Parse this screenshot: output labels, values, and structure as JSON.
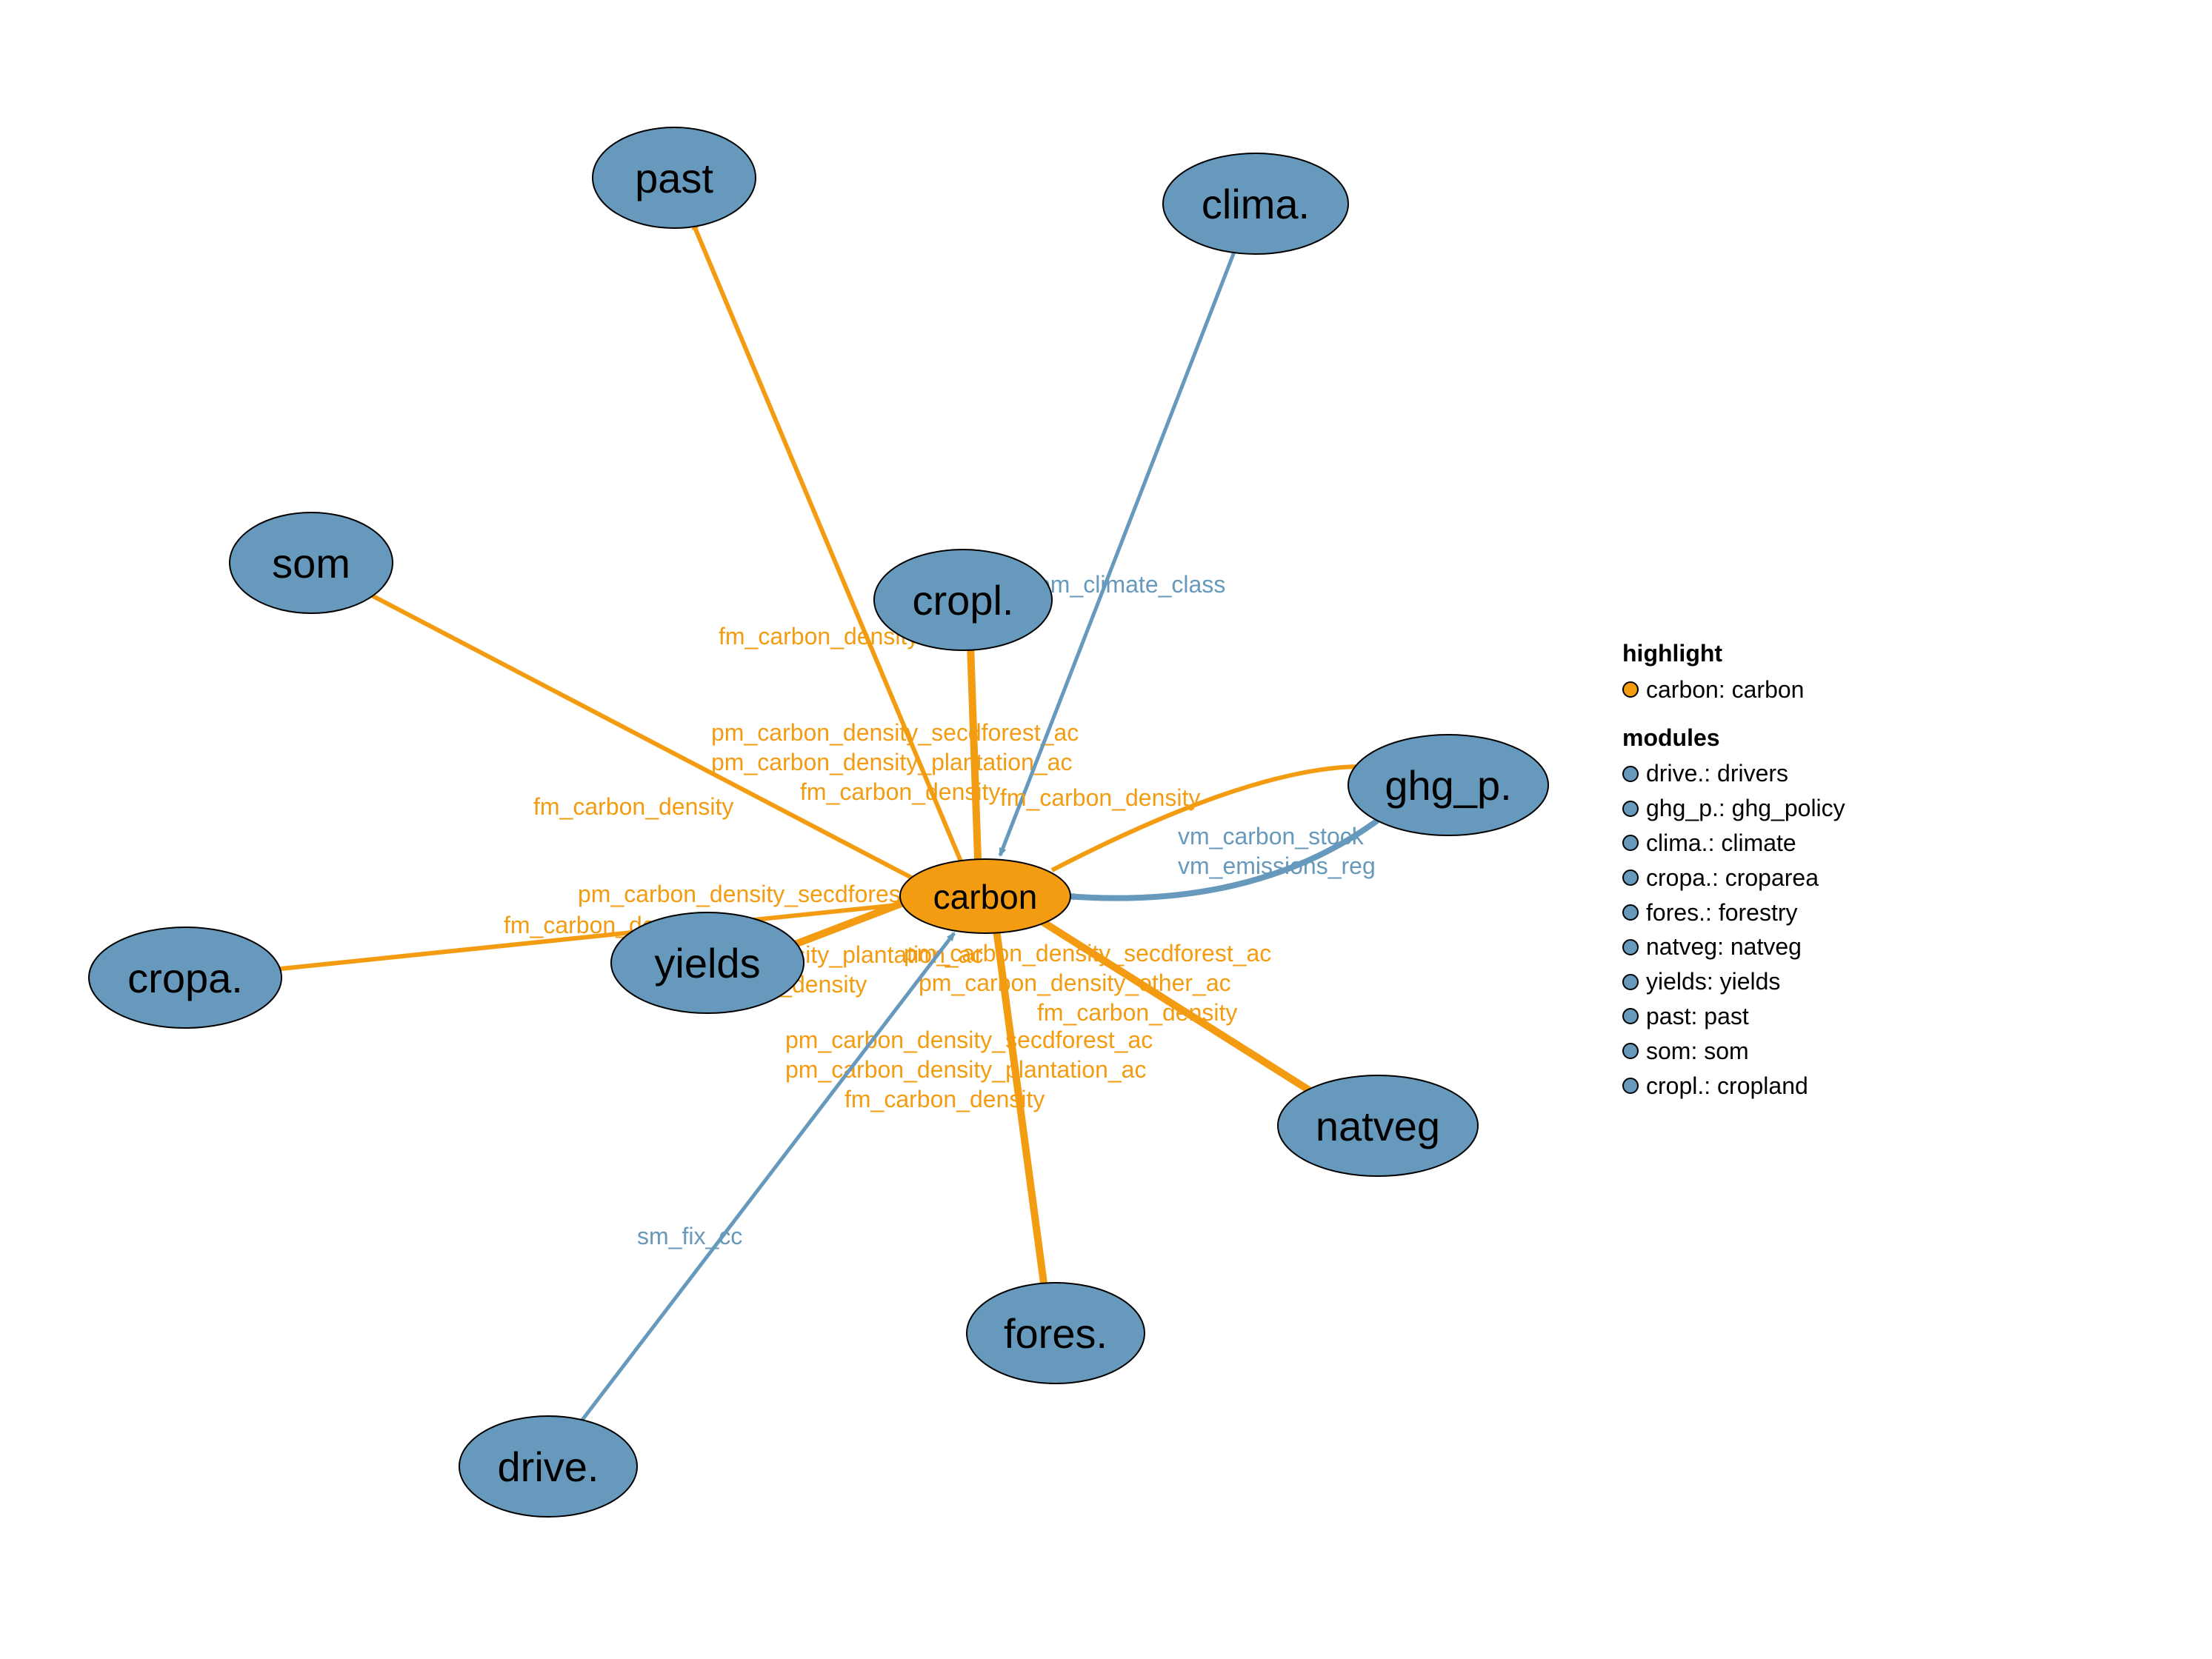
{
  "colors": {
    "node_blue": "#6699bb",
    "node_orange": "#f39c12",
    "edge_orange": "#f39c12",
    "edge_blue": "#6699bb"
  },
  "nodes": {
    "carbon": {
      "label": "carbon",
      "kind": "highlight"
    },
    "past": {
      "label": "past",
      "kind": "module"
    },
    "clima": {
      "label": "clima.",
      "kind": "module"
    },
    "som": {
      "label": "som",
      "kind": "module"
    },
    "cropl": {
      "label": "cropl.",
      "kind": "module"
    },
    "ghg_p": {
      "label": "ghg_p.",
      "kind": "module"
    },
    "cropa": {
      "label": "cropa.",
      "kind": "module"
    },
    "yields": {
      "label": "yields",
      "kind": "module"
    },
    "natveg": {
      "label": "natveg",
      "kind": "module"
    },
    "fores": {
      "label": "fores.",
      "kind": "module"
    },
    "drive": {
      "label": "drive.",
      "kind": "module"
    }
  },
  "edges": [
    {
      "from": "carbon",
      "to": "past",
      "labels": [
        "fm_carbon_density"
      ],
      "color": "orange"
    },
    {
      "from": "carbon",
      "to": "som",
      "labels": [
        "fm_carbon_density"
      ],
      "color": "orange"
    },
    {
      "from": "carbon",
      "to": "cropl",
      "labels": [
        "pm_carbon_density_secdforest_ac",
        "pm_carbon_density_plantation_ac",
        "fm_carbon_density"
      ],
      "color": "orange"
    },
    {
      "from": "carbon",
      "to": "ghg_p",
      "labels": [
        "fm_carbon_density"
      ],
      "color": "orange"
    },
    {
      "from": "ghg_p",
      "to": "carbon",
      "labels": [
        "vm_carbon_stock",
        "vm_emissions_reg"
      ],
      "color": "blue"
    },
    {
      "from": "carbon",
      "to": "cropa",
      "labels": [
        "fm_carbon_density"
      ],
      "color": "orange"
    },
    {
      "from": "carbon",
      "to": "yields",
      "labels": [
        "pm_carbon_density_secdforest_ac",
        "pm_carbon_density_plantation_ac",
        "fm_carbon_density"
      ],
      "color": "orange"
    },
    {
      "from": "carbon",
      "to": "natveg",
      "labels": [
        "pm_carbon_density_secdforest_ac",
        "pm_carbon_density_other_ac",
        "fm_carbon_density"
      ],
      "color": "orange"
    },
    {
      "from": "carbon",
      "to": "fores",
      "labels": [
        "pm_carbon_density_secdforest_ac",
        "pm_carbon_density_plantation_ac",
        "fm_carbon_density"
      ],
      "color": "orange"
    },
    {
      "from": "clima",
      "to": "carbon",
      "labels": [
        "pm_climate_class"
      ],
      "color": "blue"
    },
    {
      "from": "drive",
      "to": "carbon",
      "labels": [
        "sm_fix_cc"
      ],
      "color": "blue"
    }
  ],
  "legend": {
    "highlight_title": "highlight",
    "highlight_items": [
      {
        "label": "carbon: carbon",
        "swatch": "orange"
      }
    ],
    "modules_title": "modules",
    "modules_items": [
      {
        "label": "drive.: drivers",
        "swatch": "blue"
      },
      {
        "label": "ghg_p.: ghg_policy",
        "swatch": "blue"
      },
      {
        "label": "clima.: climate",
        "swatch": "blue"
      },
      {
        "label": "cropa.: croparea",
        "swatch": "blue"
      },
      {
        "label": "fores.: forestry",
        "swatch": "blue"
      },
      {
        "label": "natveg: natveg",
        "swatch": "blue"
      },
      {
        "label": "yields: yields",
        "swatch": "blue"
      },
      {
        "label": "past: past",
        "swatch": "blue"
      },
      {
        "label": "som: som",
        "swatch": "blue"
      },
      {
        "label": "cropl.: cropland",
        "swatch": "blue"
      }
    ]
  }
}
